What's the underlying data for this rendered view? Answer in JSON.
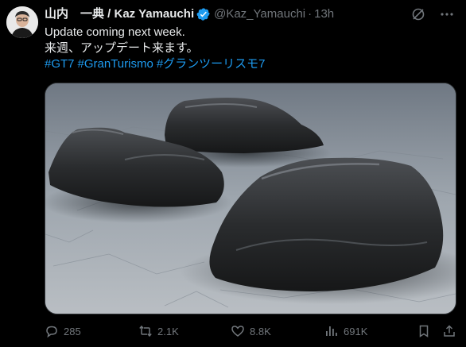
{
  "post": {
    "display_name": "山内　一典 / Kaz Yamauchi",
    "handle": "@Kaz_Yamauchi",
    "separator": "·",
    "timestamp": "13h",
    "text_lines": [
      "Update coming next week.",
      "来週、アップデート来ます。"
    ],
    "hashtags": [
      "#GT7",
      "#GranTurismo",
      "#グランツーリスモ7"
    ]
  },
  "metrics": {
    "replies": "285",
    "reposts": "2.1K",
    "likes": "8.8K",
    "views": "691K"
  },
  "icons": {
    "verified": "verified-badge-icon",
    "grok": "grok-icon",
    "more": "more-options-icon",
    "reply": "reply-icon",
    "repost": "repost-icon",
    "like": "like-icon",
    "views": "views-icon",
    "bookmark": "bookmark-icon",
    "share": "share-icon"
  },
  "colors": {
    "background": "#000000",
    "text": "#e7e9ea",
    "muted": "#71767b",
    "accent": "#1d9bf0"
  }
}
